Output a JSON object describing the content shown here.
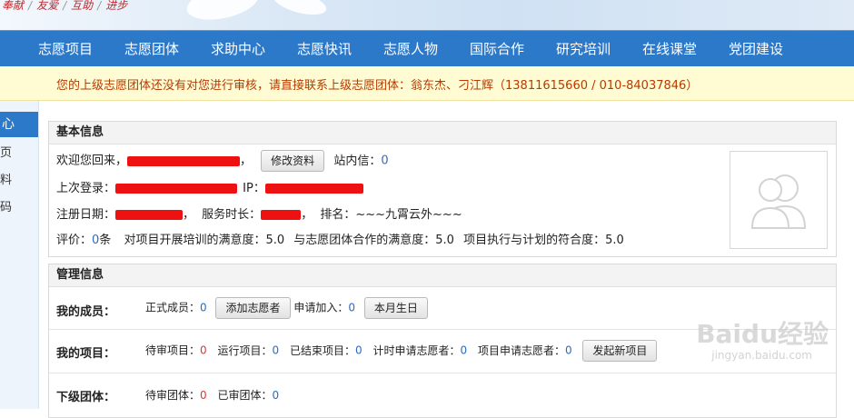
{
  "slogan": [
    "奉献",
    "友爱",
    "互助",
    "进步"
  ],
  "nav": [
    "志愿项目",
    "志愿团体",
    "求助中心",
    "志愿快讯",
    "志愿人物",
    "国际合作",
    "研究培训",
    "在线课堂",
    "党团建设"
  ],
  "notice": "您的上级志愿团体还没有对您进行审核，请直接联系上级志愿团体：翁东杰、刁江辉（13811615660 / 010-84037846）",
  "sidebar": {
    "active": "心",
    "items": [
      "页",
      "料",
      "码"
    ]
  },
  "basic": {
    "title": "基本信息",
    "welcome": "欢迎您回来，",
    "edit_btn": "修改资料",
    "msg_label": "站内信：",
    "msg_count": "0",
    "last_login": "上次登录：",
    "ip_label": "IP：",
    "reg_label": "注册日期：",
    "service_label": "服务时长：",
    "rank_label": "排名：",
    "rank_value": "~~~九霄云外~~~",
    "eval_label": "评价：",
    "eval_count": "0",
    "eval_unit": "条",
    "sat1": "对项目开展培训的满意度：5.0",
    "sat2": "与志愿团体合作的满意度：5.0",
    "sat3": "项目执行与计划的符合度：5.0"
  },
  "manage": {
    "title": "管理信息",
    "members_label": "我的成员：",
    "formal_label": "正式成员：",
    "formal_count": "0",
    "add_btn": "添加志愿者",
    "apply_label": "申请加入：",
    "apply_count": "0",
    "birthday_btn": "本月生日",
    "projects_label": "我的项目：",
    "pending_label": "待审项目：",
    "pending_count": "0",
    "running_label": "运行项目：",
    "running_count": "0",
    "ended_label": "已结束项目：",
    "ended_count": "0",
    "hourly_label": "计时申请志愿者：",
    "hourly_count": "0",
    "proj_apply_label": "项目申请志愿者：",
    "proj_apply_count": "0",
    "new_project_btn": "发起新项目",
    "sub_label": "下级团体：",
    "sub_pending_label": "待审团体：",
    "sub_pending_count": "0",
    "sub_approved_label": "已审团体：",
    "sub_approved_count": "0"
  },
  "watermark": {
    "brand": "Baidu经验",
    "url": "jingyan.baidu.com"
  }
}
